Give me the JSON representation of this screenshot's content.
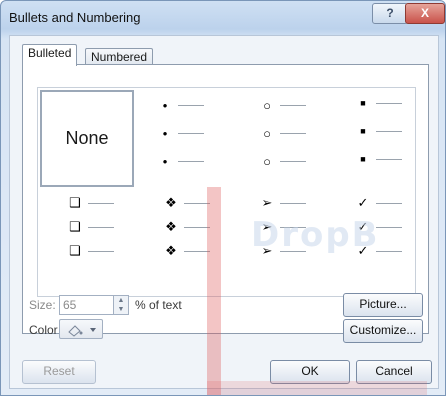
{
  "window": {
    "title": "Bullets and Numbering",
    "help_label": "?",
    "close_label": "X"
  },
  "tabs": [
    {
      "label": "Bulleted",
      "active": true
    },
    {
      "label": "Numbered",
      "active": false
    }
  ],
  "bullets": {
    "none_label": "None",
    "row1": [
      "•",
      "○",
      "■"
    ],
    "row2": [
      "❑",
      "❖",
      "➢",
      "✓"
    ]
  },
  "size": {
    "label": "Size:",
    "value": "65",
    "suffix": "% of text"
  },
  "color": {
    "label": "Color"
  },
  "buttons": {
    "picture": "Picture...",
    "customize": "Customize...",
    "reset": "Reset",
    "ok": "OK",
    "cancel": "Cancel"
  },
  "watermark": "DropB"
}
